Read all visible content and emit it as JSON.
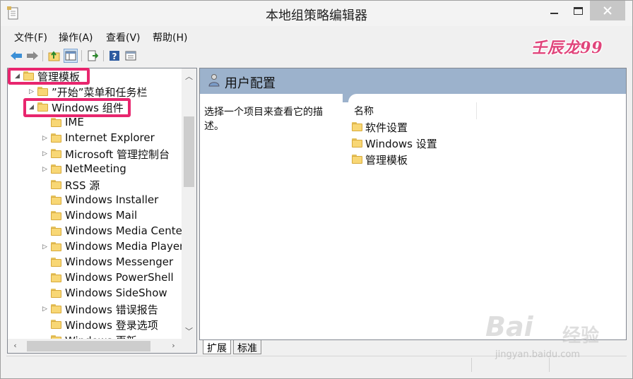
{
  "window": {
    "title": "本地组策略编辑器"
  },
  "menu": [
    "文件(F)",
    "操作(A)",
    "查看(V)",
    "帮助(H)"
  ],
  "watermark": "壬辰龙99",
  "tree": {
    "items": [
      {
        "label": "管理模板",
        "expander": "expanded",
        "level": 0
      },
      {
        "label": "”开始”菜单和任务栏",
        "expander": "collapsed",
        "level": 1
      },
      {
        "label": "Windows 组件",
        "expander": "expanded",
        "level": 1
      },
      {
        "label": "IME",
        "expander": "none",
        "level": 2
      },
      {
        "label": "Internet Explorer",
        "expander": "collapsed",
        "level": 2
      },
      {
        "label": "Microsoft 管理控制台",
        "expander": "collapsed",
        "level": 2
      },
      {
        "label": "NetMeeting",
        "expander": "collapsed",
        "level": 2
      },
      {
        "label": "RSS 源",
        "expander": "none",
        "level": 2
      },
      {
        "label": "Windows Installer",
        "expander": "none",
        "level": 2
      },
      {
        "label": "Windows Mail",
        "expander": "none",
        "level": 2
      },
      {
        "label": "Windows Media Cente",
        "expander": "none",
        "level": 2
      },
      {
        "label": "Windows Media Player",
        "expander": "collapsed",
        "level": 2
      },
      {
        "label": "Windows Messenger",
        "expander": "none",
        "level": 2
      },
      {
        "label": "Windows PowerShell",
        "expander": "none",
        "level": 2
      },
      {
        "label": "Windows SideShow",
        "expander": "none",
        "level": 2
      },
      {
        "label": "Windows 错误报告",
        "expander": "collapsed",
        "level": 2
      },
      {
        "label": "Windows 登录选项",
        "expander": "none",
        "level": 2
      },
      {
        "label": "Windows 更新",
        "expander": "none",
        "level": 2
      }
    ]
  },
  "right_pane": {
    "header_title": "用户配置",
    "description": "选择一个项目来查看它的描述。",
    "column_header": "名称",
    "items": [
      "软件设置",
      "Windows 设置",
      "管理模板"
    ]
  },
  "bottom_tabs": [
    "扩展",
    "标准"
  ],
  "baidu": {
    "logo_text": "Bai",
    "logo_suffix": "经验",
    "url": "jingyan.baidu.com"
  },
  "colors": {
    "highlight_box": "#e8266e",
    "header_bg": "#9cb2cc",
    "folder": "#f8d775"
  }
}
